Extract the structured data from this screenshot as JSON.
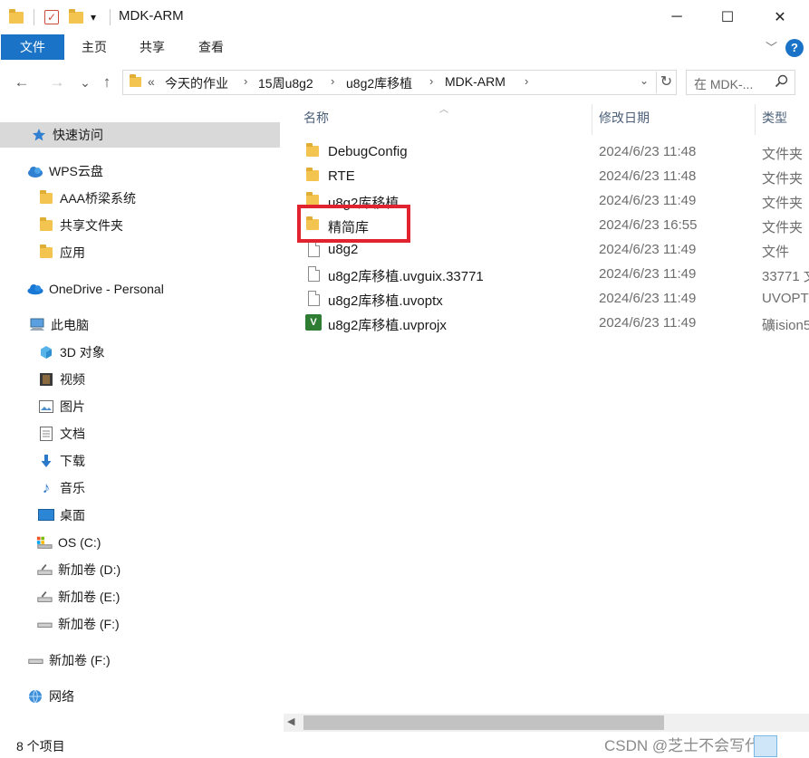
{
  "window": {
    "title": "MDK-ARM",
    "minimize_glyph": "─",
    "maximize_glyph": "☐",
    "close_glyph": "✕",
    "qa_customize_glyph": "▾"
  },
  "ribbon": {
    "tabs": [
      "文件",
      "主页",
      "共享",
      "查看"
    ],
    "expand_glyph": "﹀",
    "help_glyph": "?"
  },
  "nav": {
    "back_glyph": "←",
    "forward_glyph": "→",
    "recent_glyph": "⌄",
    "up_glyph": "↑"
  },
  "address": {
    "overflow": "«",
    "crumbs": [
      "今天的作业",
      "15周u8g2",
      "u8g2库移植",
      "MDK-ARM"
    ],
    "separator": "›",
    "dropdown_glyph": "⌄",
    "refresh_glyph": "↻"
  },
  "search": {
    "placeholder": "在 MDK-...",
    "icon": "search-icon"
  },
  "navpane": {
    "items": [
      {
        "label": "快速访问",
        "icon": "star-icon"
      },
      {
        "label": "WPS云盘",
        "icon": "cloud-icon"
      },
      {
        "label": "AAA桥梁系统",
        "icon": "shared-folder-icon"
      },
      {
        "label": "共享文件夹",
        "icon": "shared-folder-icon"
      },
      {
        "label": "应用",
        "icon": "apps-folder-icon"
      },
      {
        "label": "OneDrive - Personal",
        "icon": "onedrive-icon"
      },
      {
        "label": "此电脑",
        "icon": "computer-icon"
      },
      {
        "label": "3D 对象",
        "icon": "3d-objects-icon"
      },
      {
        "label": "视频",
        "icon": "video-icon"
      },
      {
        "label": "图片",
        "icon": "pictures-icon"
      },
      {
        "label": "文档",
        "icon": "documents-icon"
      },
      {
        "label": "下载",
        "icon": "downloads-icon"
      },
      {
        "label": "音乐",
        "icon": "music-icon"
      },
      {
        "label": "桌面",
        "icon": "desktop-icon"
      },
      {
        "label": "OS (C:)",
        "icon": "system-drive-icon"
      },
      {
        "label": "新加卷 (D:)",
        "icon": "drive-icon"
      },
      {
        "label": "新加卷 (E:)",
        "icon": "drive-icon"
      },
      {
        "label": "新加卷 (F:)",
        "icon": "drive-icon"
      },
      {
        "label": "新加卷 (F:)",
        "icon": "drive-icon"
      },
      {
        "label": "网络",
        "icon": "network-icon"
      }
    ]
  },
  "filelist": {
    "columns": [
      "名称",
      "修改日期",
      "类型"
    ],
    "rows": [
      {
        "name": "DebugConfig",
        "date": "2024/6/23 11:48",
        "type": "文件夹",
        "icon": "folder-icon"
      },
      {
        "name": "RTE",
        "date": "2024/6/23 11:48",
        "type": "文件夹",
        "icon": "folder-icon"
      },
      {
        "name": "u8g2库移植",
        "date": "2024/6/23 11:49",
        "type": "文件夹",
        "icon": "folder-icon"
      },
      {
        "name": "精简库",
        "date": "2024/6/23 16:55",
        "type": "文件夹",
        "icon": "folder-icon"
      },
      {
        "name": "u8g2",
        "date": "2024/6/23 11:49",
        "type": "文件",
        "icon": "file-icon"
      },
      {
        "name": "u8g2库移植.uvguix.33771",
        "date": "2024/6/23 11:49",
        "type": "33771 文",
        "icon": "file-icon"
      },
      {
        "name": "u8g2库移植.uvoptx",
        "date": "2024/6/23 11:49",
        "type": "UVOPTX",
        "icon": "file-icon"
      },
      {
        "name": "u8g2库移植.uvprojx",
        "date": "2024/6/23 11:49",
        "type": "礦ision5",
        "icon": "uvision-icon"
      }
    ],
    "highlight_color": "#e0232e"
  },
  "status": {
    "count": "8 个项目",
    "watermark": "CSDN @芝士不会写代码"
  },
  "colors": {
    "accent": "#1a73c6",
    "folder": "#f3c550",
    "highlight": "#e0232e"
  }
}
